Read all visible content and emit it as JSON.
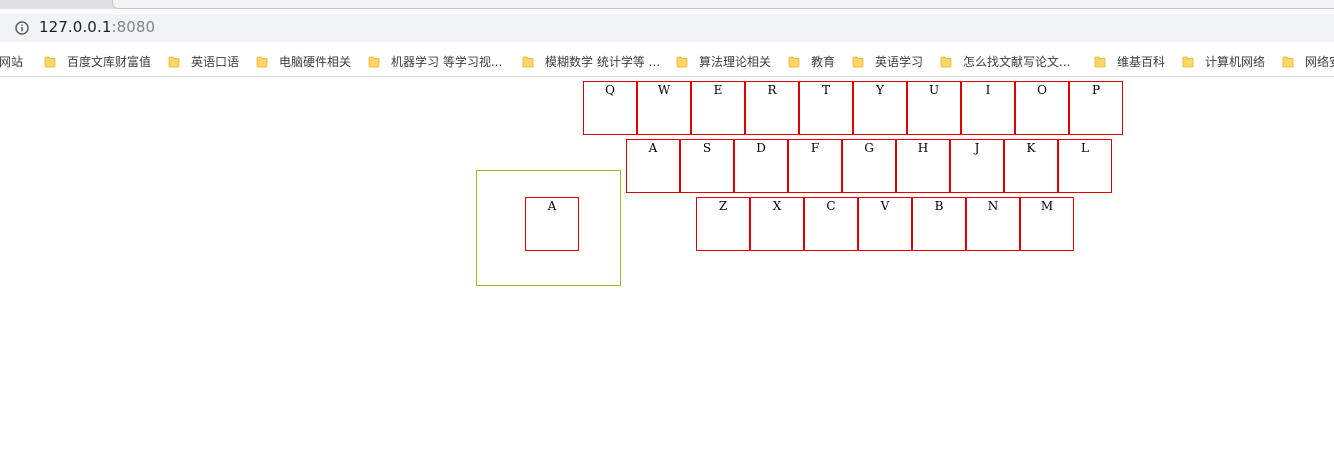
{
  "browser": {
    "url_host": "127.0.0.1",
    "url_port": ":8080",
    "bookmarks": [
      {
        "label": "网站",
        "has_icon": false
      },
      {
        "label": "百度文库财富值",
        "has_icon": true
      },
      {
        "label": "英语口语",
        "has_icon": true
      },
      {
        "label": "电脑硬件相关",
        "has_icon": true
      },
      {
        "label": "机器学习 等学习视...",
        "has_icon": true
      },
      {
        "label": "模糊数学 统计学等 ...",
        "has_icon": true
      },
      {
        "label": "算法理论相关",
        "has_icon": true
      },
      {
        "label": "教育",
        "has_icon": true
      },
      {
        "label": "英语学习",
        "has_icon": true
      },
      {
        "label": "怎么找文献写论文...",
        "has_icon": true
      },
      {
        "label": "维基百科",
        "has_icon": true
      },
      {
        "label": "计算机网络",
        "has_icon": true
      },
      {
        "label": "网络安",
        "has_icon": true
      }
    ]
  },
  "keyboard": {
    "rows": [
      [
        "Q",
        "W",
        "E",
        "R",
        "T",
        "Y",
        "U",
        "I",
        "O",
        "P"
      ],
      [
        "A",
        "S",
        "D",
        "F",
        "G",
        "H",
        "J",
        "K",
        "L"
      ],
      [
        "Z",
        "X",
        "C",
        "V",
        "B",
        "N",
        "M"
      ]
    ]
  },
  "drop_zone": {
    "key_label": "A"
  },
  "colors": {
    "key_border": "#e00000",
    "drop_zone_border": "#99bb22",
    "bookmark_folder": "#fdd663"
  }
}
